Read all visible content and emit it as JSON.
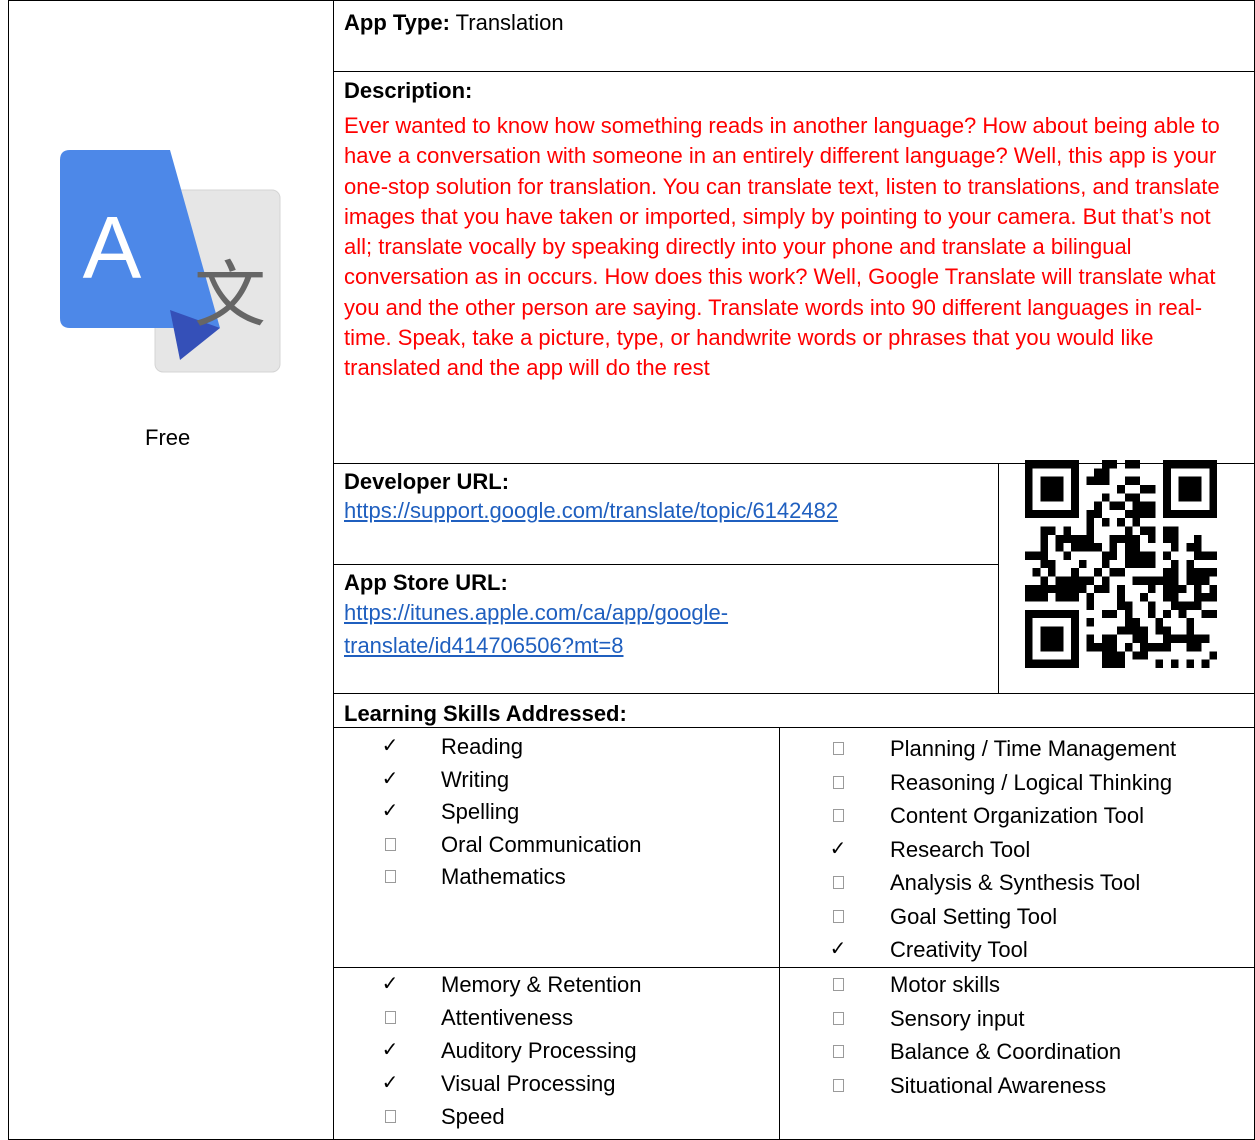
{
  "left": {
    "price": "Free",
    "icon": "google-translate-icon"
  },
  "app_type": {
    "label": "App Type:",
    "value": "Translation"
  },
  "description": {
    "label": "Description:",
    "text": "Ever wanted to know how something reads in another language? How about being able to have a conversation with someone in an entirely different language? Well, this app is your one-stop solution for translation. You can translate text, listen to translations, and translate images that you have taken or imported, simply by pointing to your camera. But that’s not all; translate vocally by speaking directly into your phone and translate a bilingual conversation as in occurs. How does this work? Well, Google Translate will translate what you and the other person are saying. Translate words into 90 different languages in real-time. Speak, take a picture, type, or handwrite words or phrases that you would like translated and the app will do the rest",
    "color": "#ff0000"
  },
  "developer": {
    "label": "Developer URL:",
    "url": "https://support.google.com/translate/topic/6142482"
  },
  "app_store": {
    "label": "App Store URL:",
    "url_line1": "https://itunes.apple.com/ca/app/google-",
    "url_line2": "translate/id414706506?mt=8"
  },
  "qr_icon": "qr-code-icon",
  "skills": {
    "label": "Learning Skills Addressed:",
    "check_glyph": "✓",
    "col1": [
      {
        "name": "Reading",
        "checked": true
      },
      {
        "name": "Writing",
        "checked": true
      },
      {
        "name": "Spelling",
        "checked": true
      },
      {
        "name": "Oral Communication",
        "checked": false
      },
      {
        "name": "Mathematics",
        "checked": false
      }
    ],
    "col2": [
      {
        "name": "Planning / Time Management",
        "checked": false
      },
      {
        "name": "Reasoning / Logical Thinking",
        "checked": false
      },
      {
        "name": "Content Organization Tool",
        "checked": false
      },
      {
        "name": "Research Tool",
        "checked": true
      },
      {
        "name": "Analysis & Synthesis Tool",
        "checked": false
      },
      {
        "name": "Goal Setting Tool",
        "checked": false
      },
      {
        "name": "Creativity Tool",
        "checked": true
      }
    ],
    "col3": [
      {
        "name": "Memory & Retention",
        "checked": true
      },
      {
        "name": "Attentiveness",
        "checked": false
      },
      {
        "name": "Auditory Processing",
        "checked": true
      },
      {
        "name": "Visual Processing",
        "checked": true
      },
      {
        "name": "Speed",
        "checked": false
      }
    ],
    "col4": [
      {
        "name": "Motor skills",
        "checked": false
      },
      {
        "name": "Sensory input",
        "checked": false
      },
      {
        "name": "Balance & Coordination",
        "checked": false
      },
      {
        "name": "Situational Awareness",
        "checked": false
      }
    ]
  }
}
